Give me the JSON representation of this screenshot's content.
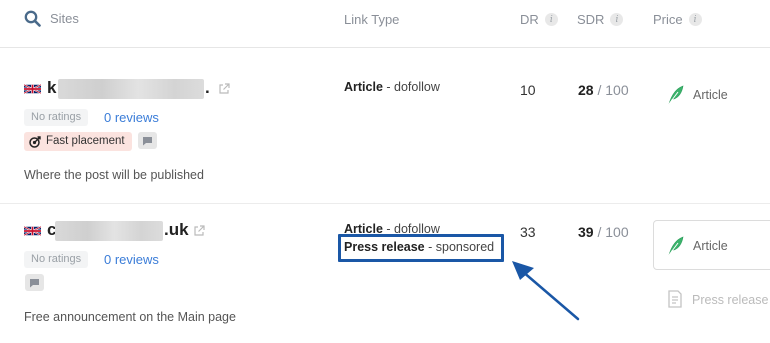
{
  "header": {
    "sites": "Sites",
    "link_type": "Link Type",
    "dr": "DR",
    "sdr": "SDR",
    "price": "Price",
    "info_glyph": "i"
  },
  "rows": [
    {
      "name_prefix": "k",
      "name_suffix": ".",
      "ratings": "No ratings",
      "reviews": "0 reviews",
      "badge": "Fast placement",
      "description": "Where the post will be published",
      "link_types": [
        {
          "kind": "Article",
          "sep": " - ",
          "attr": "dofollow"
        }
      ],
      "dr": "10",
      "sdr_value": "28",
      "sdr_total": " / 100",
      "prices": [
        {
          "label": "Article"
        }
      ]
    },
    {
      "name_prefix": "c",
      "name_suffix": ".uk",
      "ratings": "No ratings",
      "reviews": "0 reviews",
      "description": "Free announcement on the Main page",
      "link_types": [
        {
          "kind": "Article",
          "sep": " - ",
          "attr": "dofollow"
        },
        {
          "kind": "Press release",
          "sep": " - ",
          "attr": "sponsored"
        }
      ],
      "dr": "33",
      "sdr_value": "39",
      "sdr_total": " / 100",
      "prices": [
        {
          "label": "Article"
        },
        {
          "label": "Press release"
        }
      ]
    }
  ],
  "colors": {
    "accent_blue": "#3b7dd8",
    "highlight": "#1a57a6",
    "fast_badge_bg": "#fbe3df",
    "feather_green": "#3bb36b"
  },
  "icons": [
    "search-icon",
    "info-icon",
    "uk-flag-icon",
    "external-link-icon",
    "target-icon",
    "chat-icon",
    "feather-icon",
    "document-edit-icon",
    "arrow-annotation"
  ]
}
